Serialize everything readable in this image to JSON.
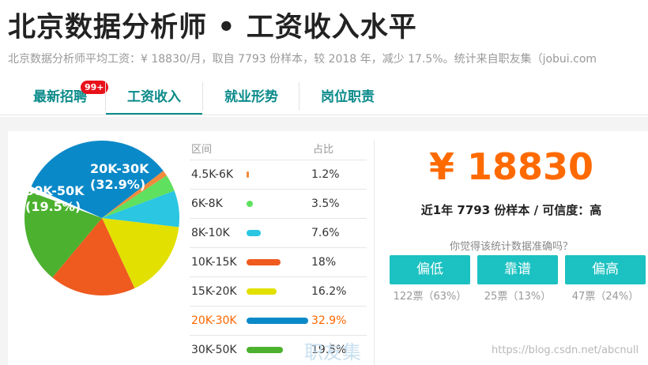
{
  "page": {
    "title": "北京数据分析师 • 工资收入水平",
    "subtitle": "北京数据分析师平均工资：¥ 18830/月，取自 7793 份样本，较 2018 年，减少 17.5%。统计来自职友集（jobui.com"
  },
  "tabs": [
    {
      "label": "最新招聘",
      "badge": "99+"
    },
    {
      "label": "工资收入",
      "active": true
    },
    {
      "label": "就业形势"
    },
    {
      "label": "岗位职责"
    }
  ],
  "table": {
    "header_range": "区间",
    "header_pct": "占比",
    "rows": [
      {
        "range": "4.5K-6K",
        "pct": "1.2%",
        "value": 1.2,
        "color": "#f08a3c"
      },
      {
        "range": "6K-8K",
        "pct": "3.5%",
        "value": 3.5,
        "color": "#5fe05f"
      },
      {
        "range": "8K-10K",
        "pct": "7.6%",
        "value": 7.6,
        "color": "#2ac6e2"
      },
      {
        "range": "10K-15K",
        "pct": "18%",
        "value": 18,
        "color": "#ef5a1f"
      },
      {
        "range": "15K-20K",
        "pct": "16.2%",
        "value": 16.2,
        "color": "#e2e000"
      },
      {
        "range": "20K-30K",
        "pct": "32.9%",
        "value": 32.9,
        "color": "#0a89c8",
        "highlight": true
      },
      {
        "range": "30K-50K",
        "pct": "19.5%",
        "value": 19.5,
        "color": "#4cb12f"
      }
    ]
  },
  "pie_labels": [
    {
      "line1": "20K-30K",
      "line2": "(32.9%)"
    },
    {
      "line1": "30K-50K",
      "line2": "(19.5%)"
    }
  ],
  "summary": {
    "salary": "¥ 18830",
    "sample_line": "近1年 7793 份样本 / 可信度：高",
    "question": "你觉得该统计数据准确吗？"
  },
  "votes": [
    {
      "label": "偏低",
      "count": "122票（63%）"
    },
    {
      "label": "靠谱",
      "count": "25票（13%）"
    },
    {
      "label": "偏高",
      "count": "47票（24%）"
    }
  ],
  "watermarks": {
    "jobui": "职友集",
    "url": "https://blog.csdn.net/abcnull"
  }
}
